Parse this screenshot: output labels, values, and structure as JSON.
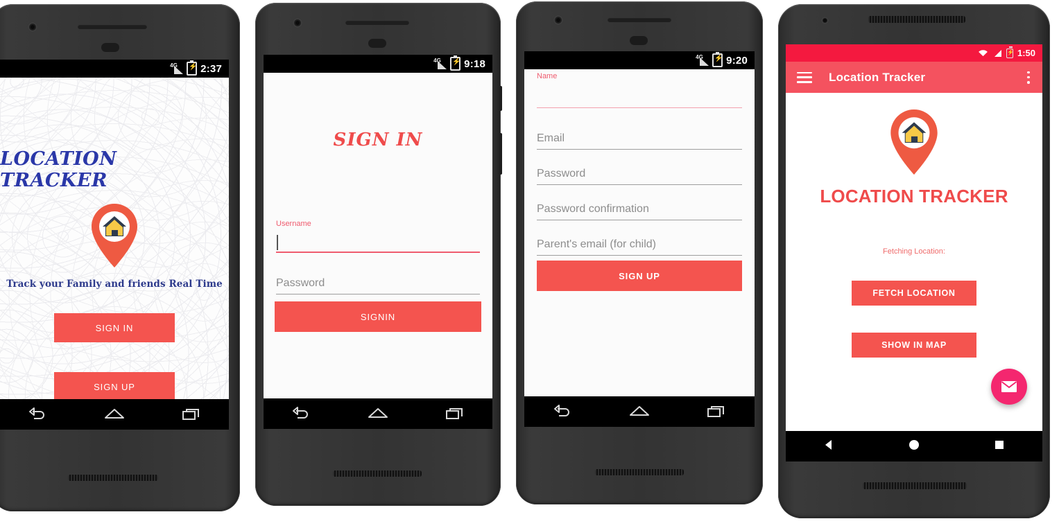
{
  "accent": {
    "button_red": "#f4544f",
    "appbar_red": "#f4525f",
    "statusbar_red": "#f4193f",
    "title_red": "#ef4b4b",
    "fab_pink": "#f4276f",
    "splash_blue": "#2a37a8",
    "pin_orange": "#ee5a42",
    "house_yellow": "#f7c947",
    "roof_navy": "#2e3b4e",
    "field_underline": "#9e9e9e",
    "field_label_pink": "#ef5b6e"
  },
  "phones": [
    {
      "id": "phone-splash",
      "status_bar": {
        "time": "2:37",
        "network_label": "4G",
        "icons": [
          "signal-icon",
          "battery-charging-icon"
        ]
      },
      "screen": {
        "app_title": "LOCATION TRACKER",
        "tagline": "Track your Family and friends Real Time",
        "logo_icon": "location-pin-home-icon",
        "buttons": [
          {
            "label": "SIGN IN",
            "name": "sign-in-button"
          },
          {
            "label": "SIGN UP",
            "name": "sign-up-button"
          }
        ]
      },
      "nav_bar": {
        "style": "kitkat",
        "buttons": [
          "back-icon",
          "home-icon",
          "recents-icon"
        ]
      }
    },
    {
      "id": "phone-signin",
      "status_bar": {
        "time": "9:18",
        "network_label": "4G",
        "icons": [
          "signal-icon",
          "battery-charging-icon"
        ]
      },
      "screen": {
        "heading": "SIGN IN",
        "fields": [
          {
            "name": "username-field",
            "label": "Username",
            "value": "",
            "placeholder": "Username",
            "focused": true
          },
          {
            "name": "password-field",
            "label": "",
            "value": "",
            "placeholder": "Password",
            "focused": false
          }
        ],
        "submit": {
          "label": "SIGNIN",
          "name": "signin-button"
        }
      },
      "nav_bar": {
        "style": "kitkat",
        "buttons": [
          "back-icon",
          "home-icon",
          "recents-icon"
        ]
      }
    },
    {
      "id": "phone-signup",
      "status_bar": {
        "time": "9:20",
        "network_label": "4G",
        "icons": [
          "signal-icon",
          "battery-charging-icon"
        ]
      },
      "screen": {
        "fields": [
          {
            "name": "name-field",
            "label": "Name",
            "value": "",
            "placeholder": "Name",
            "focused": true
          },
          {
            "name": "email-field",
            "label": "",
            "value": "",
            "placeholder": "Email",
            "focused": false
          },
          {
            "name": "password-field",
            "label": "",
            "value": "",
            "placeholder": "Password",
            "focused": false
          },
          {
            "name": "password-confirmation-field",
            "label": "",
            "value": "",
            "placeholder": "Password confirmation",
            "focused": false
          },
          {
            "name": "parent-email-field",
            "label": "",
            "value": "",
            "placeholder": "Parent's email (for child)",
            "focused": false
          }
        ],
        "submit": {
          "label": "SIGN UP",
          "name": "signup-button"
        }
      },
      "nav_bar": {
        "style": "kitkat",
        "buttons": [
          "back-icon",
          "home-icon",
          "recents-icon"
        ]
      }
    },
    {
      "id": "phone-main",
      "status_bar": {
        "time": "1:50",
        "icons": [
          "wifi-icon",
          "signal-icon",
          "battery-charging-icon"
        ]
      },
      "app_bar": {
        "menu_icon": "hamburger-menu-icon",
        "title": "Location Tracker",
        "overflow_icon": "kebab-menu-icon"
      },
      "screen": {
        "logo_icon": "location-pin-home-icon",
        "title": "LOCATION TRACKER",
        "status_text": "Fetching Location:",
        "buttons": [
          {
            "label": "FETCH LOCATION",
            "name": "fetch-location-button"
          },
          {
            "label": "SHOW IN MAP",
            "name": "show-in-map-button"
          }
        ],
        "fab": {
          "icon": "envelope-icon",
          "name": "message-fab"
        }
      },
      "nav_bar": {
        "style": "lollipop",
        "buttons": [
          "back-triangle-icon",
          "home-circle-icon",
          "recents-square-icon"
        ]
      }
    }
  ]
}
